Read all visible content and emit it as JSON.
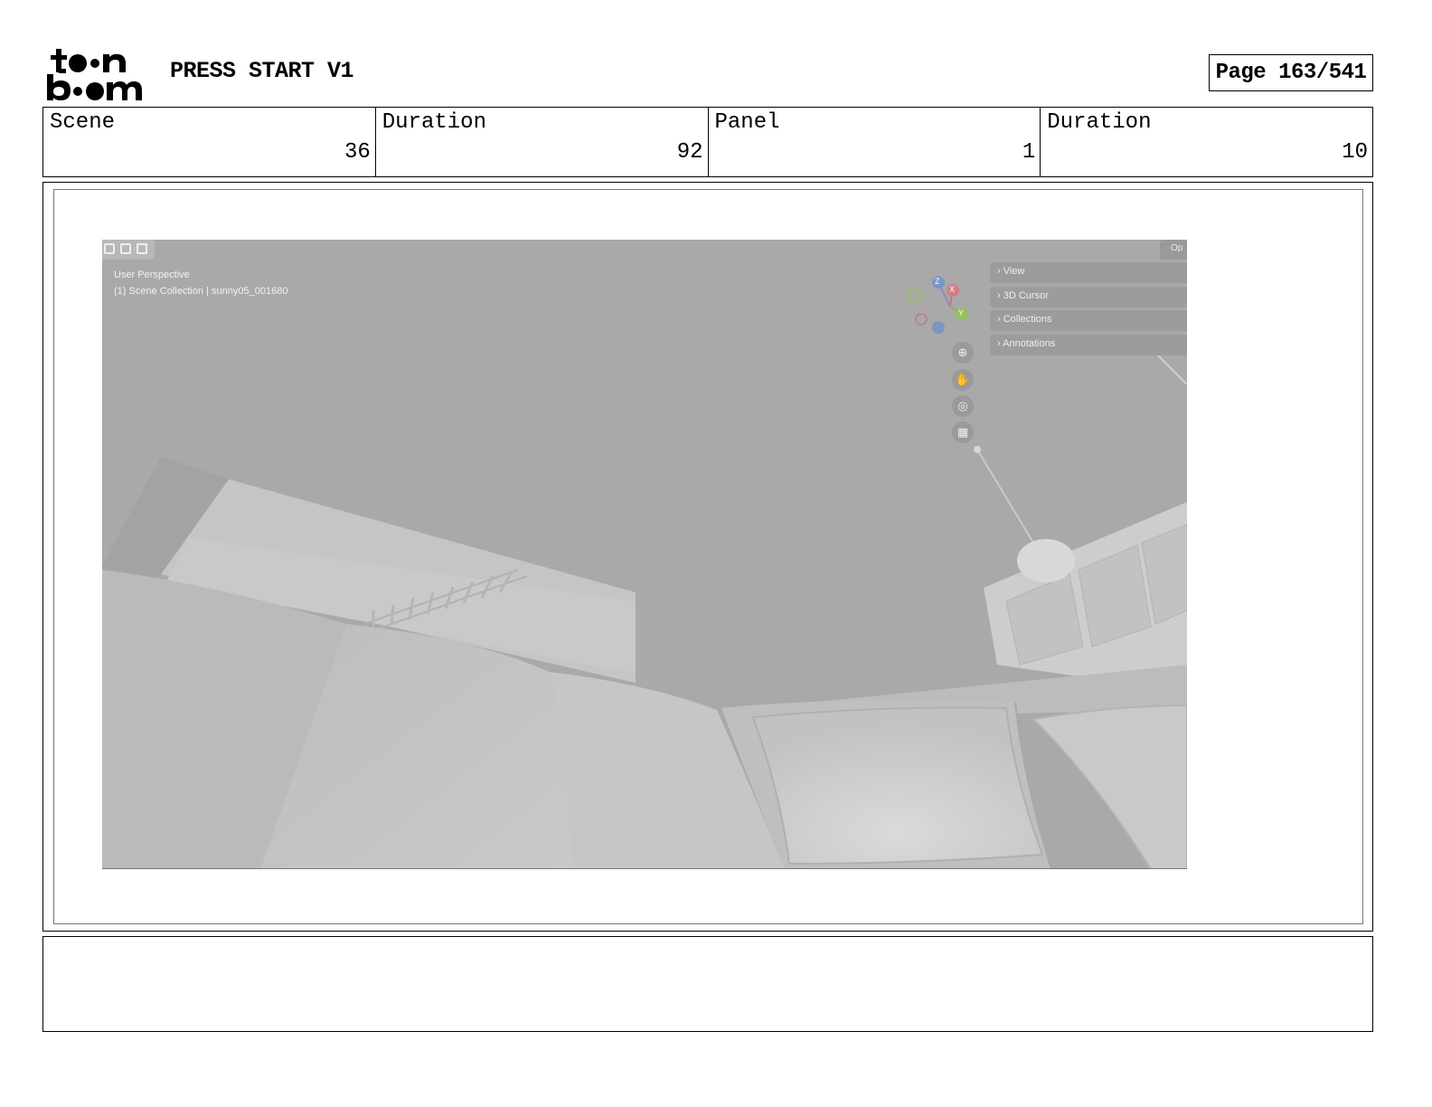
{
  "header": {
    "logo_text_top": "t n",
    "logo_text_bottom": "b m",
    "project_title": "PRESS START V1",
    "page_label": "Page 163/541"
  },
  "info": [
    {
      "label": "Scene",
      "value": "36"
    },
    {
      "label": "Duration",
      "value": "92"
    },
    {
      "label": "Panel",
      "value": "1"
    },
    {
      "label": "Duration",
      "value": "10"
    }
  ],
  "viewport": {
    "label_perspective": "User Perspective",
    "label_collection": "(1) Scene Collection | sunny05_001680",
    "op_label": "Op",
    "sidebar_panels": [
      "View",
      "3D Cursor",
      "Collections",
      "Annotations"
    ],
    "gizmo_axes": [
      "Z",
      "X",
      "Y"
    ],
    "nav_buttons": [
      {
        "icon": "zoom-icon",
        "glyph": "⊕"
      },
      {
        "icon": "hand-pan-icon",
        "glyph": "✋"
      },
      {
        "icon": "camera-icon",
        "glyph": "◎"
      },
      {
        "icon": "grid-perspective-icon",
        "glyph": "▦"
      }
    ]
  },
  "notes": ""
}
